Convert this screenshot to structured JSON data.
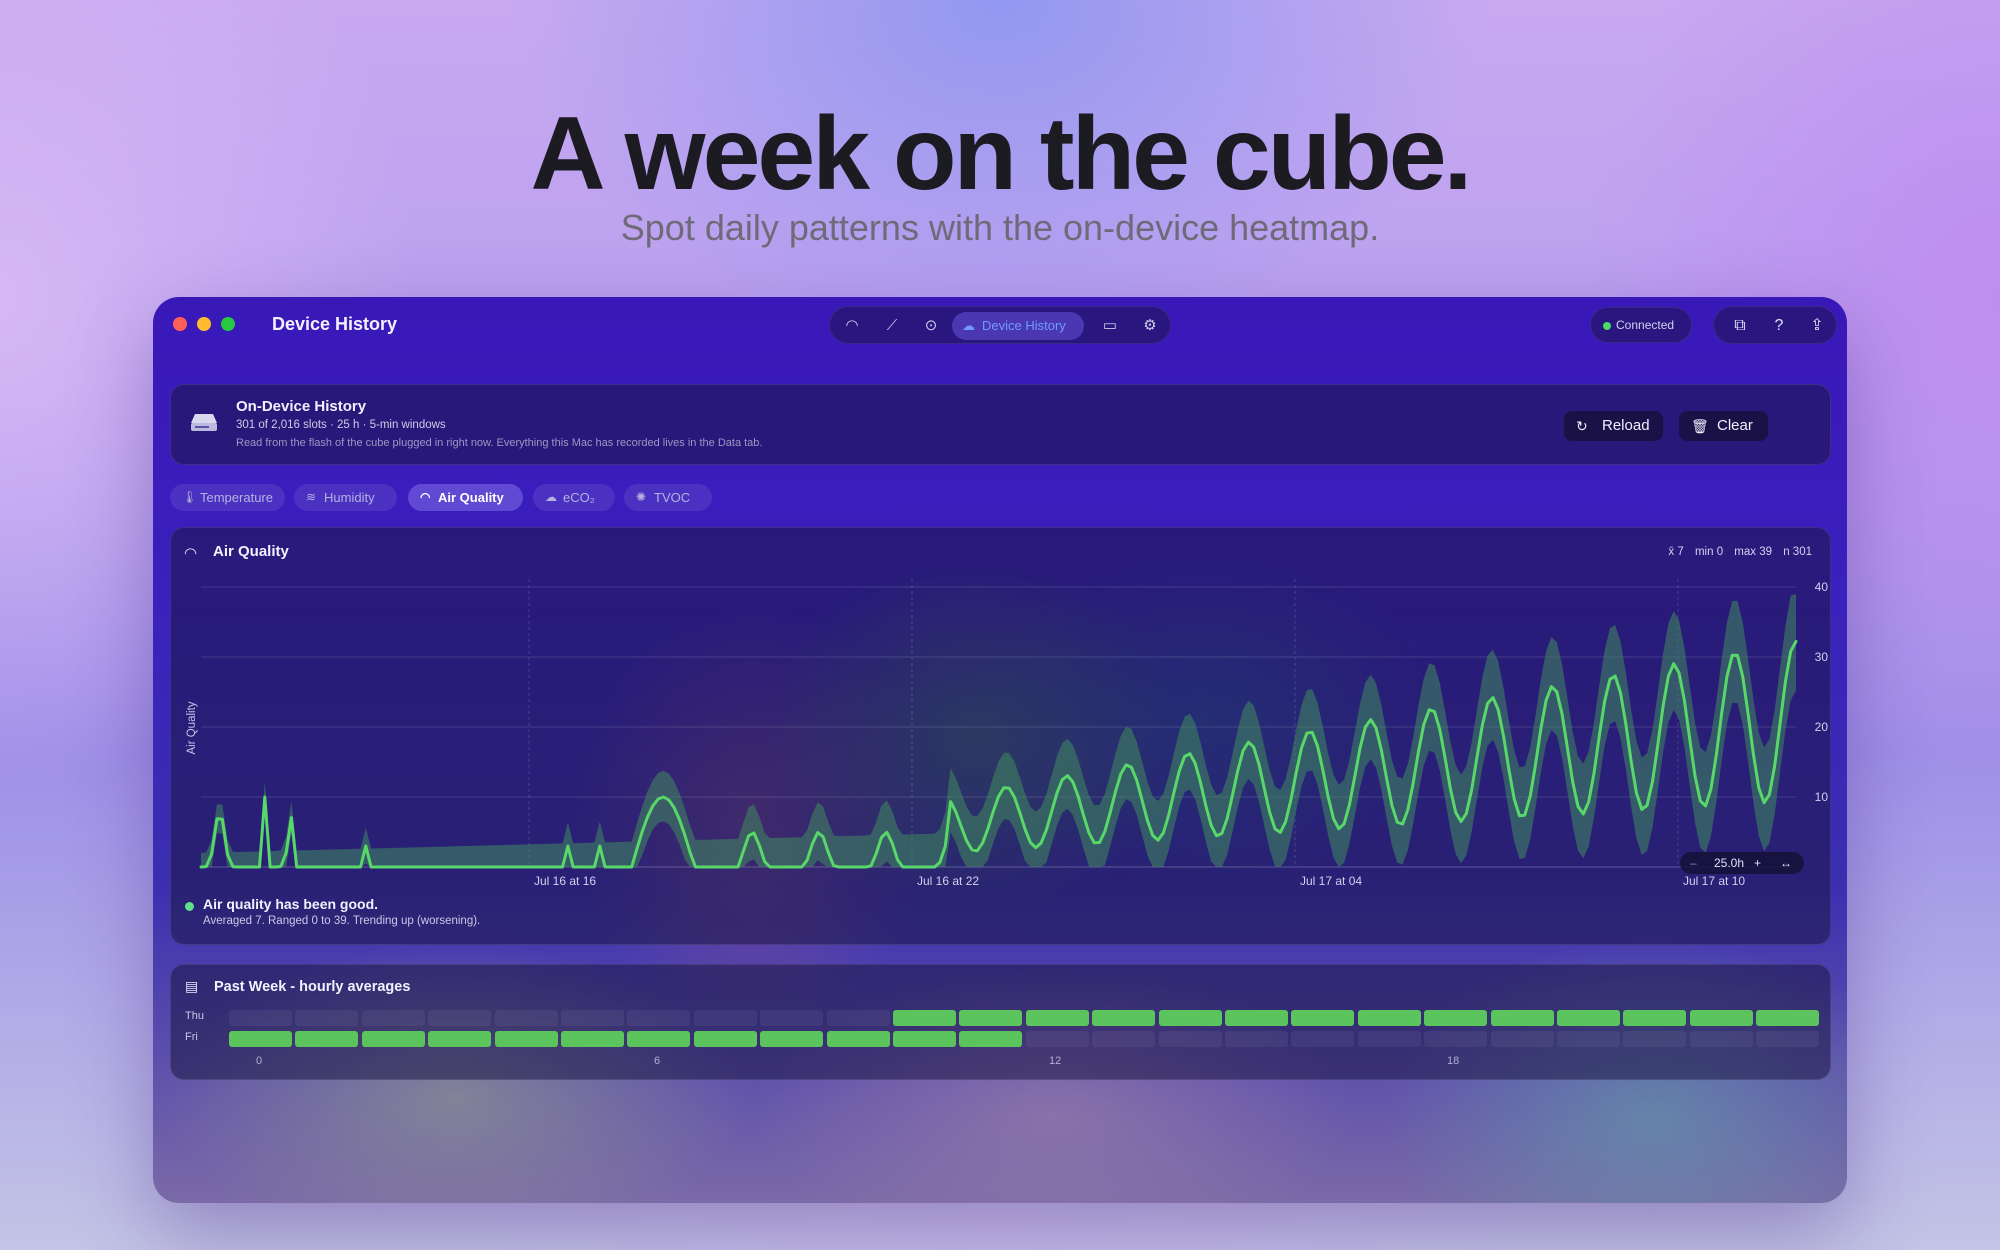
{
  "hero": {
    "title": "A week on the cube.",
    "subtitle": "Spot daily patterns with the on-device heatmap."
  },
  "window": {
    "title": "Device History",
    "toolbar": {
      "items": [
        "gauge-icon",
        "chart-icon",
        "target-icon",
        "Device History",
        "card-icon",
        "gear-icon"
      ],
      "active_label": "Device History"
    },
    "status": "Connected",
    "right_tools": [
      "windows-icon",
      "help-icon",
      "share-icon"
    ]
  },
  "history": {
    "title": "On-Device History",
    "meta": "301 of 2,016 slots · 25 h · 5-min windows",
    "note": "Read from the flash of the cube plugged in right now. Everything this Mac has recorded lives in the Data tab.",
    "reload_label": "Reload",
    "clear_label": "Clear"
  },
  "tabs": [
    {
      "label": "Temperature",
      "icon": "thermometer-icon"
    },
    {
      "label": "Humidity",
      "icon": "humidity-icon"
    },
    {
      "label": "Air Quality",
      "icon": "gauge-icon",
      "active": true
    },
    {
      "label": "eCO₂",
      "icon": "cloud-icon"
    },
    {
      "label": "TVOC",
      "icon": "sparkle-icon"
    }
  ],
  "chart": {
    "title": "Air Quality",
    "stats": {
      "mean": "x̄ 7",
      "min": "min 0",
      "max": "max 39",
      "n": "n 301"
    },
    "zoom": "25.0h",
    "summary_title": "Air quality has been good.",
    "summary_text": "Averaged 7. Ranged 0 to 39. Trending up (worsening).",
    "colors": {
      "line": "#59d86a",
      "band": "#3f8a5e",
      "status": "#5ee08a"
    }
  },
  "chart_data": {
    "type": "line",
    "title": "Air Quality",
    "ylabel": "Air Quality",
    "ylim": [
      0,
      40
    ],
    "yticks": [
      10,
      20,
      30,
      40
    ],
    "xticks": [
      "Jul 16 at 16",
      "Jul 16 at 22",
      "Jul 17 at 04",
      "Jul 17 at 10"
    ],
    "grid": true,
    "series": [
      {
        "name": "Air Quality",
        "points": 301,
        "min": 0,
        "max": 39,
        "mean": 7
      }
    ]
  },
  "week": {
    "title": "Past Week - hourly averages",
    "rows": [
      {
        "label": "Thu",
        "filled": [
          false,
          false,
          false,
          false,
          false,
          false,
          false,
          false,
          false,
          false,
          true,
          true,
          true,
          true,
          true,
          true,
          true,
          true,
          true,
          true,
          true,
          true,
          true,
          true
        ]
      },
      {
        "label": "Fri",
        "filled": [
          true,
          true,
          true,
          true,
          true,
          true,
          true,
          true,
          true,
          true,
          true,
          true,
          false,
          false,
          false,
          false,
          false,
          false,
          false,
          false,
          false,
          false,
          false,
          false
        ]
      }
    ],
    "hour_labels": [
      "0",
      "6",
      "12",
      "18"
    ],
    "colors": {
      "filled": "#5cc45d",
      "empty": "rgba(255,255,255,0.06)"
    }
  }
}
